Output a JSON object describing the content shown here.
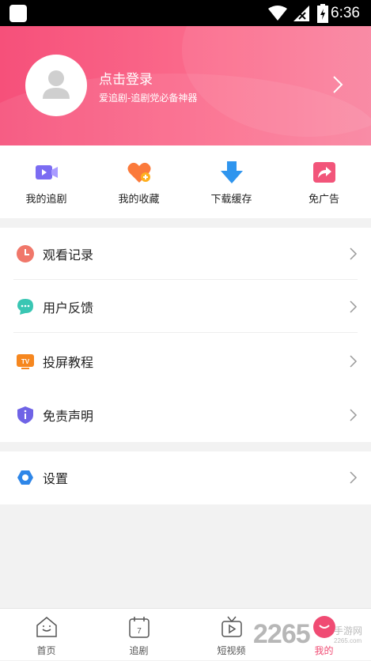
{
  "status_bar": {
    "time": "6:36"
  },
  "profile": {
    "title": "点击登录",
    "subtitle": "爱追剧-追剧党必备神器"
  },
  "quick_actions": [
    {
      "label": "我的追剧",
      "icon": "video-icon"
    },
    {
      "label": "我的收藏",
      "icon": "heart-add-icon"
    },
    {
      "label": "下载缓存",
      "icon": "download-icon"
    },
    {
      "label": "免广告",
      "icon": "share-icon"
    }
  ],
  "menu": [
    {
      "label": "观看记录",
      "icon": "clock-icon"
    },
    {
      "label": "用户反馈",
      "icon": "chat-icon"
    },
    {
      "label": "投屏教程",
      "icon": "tv-icon"
    },
    {
      "label": "免责声明",
      "icon": "shield-info-icon"
    }
  ],
  "settings": {
    "label": "设置",
    "icon": "hexagon-settings-icon"
  },
  "tabs": [
    {
      "label": "首页",
      "icon": "home-icon"
    },
    {
      "label": "追剧",
      "icon": "calendar-icon"
    },
    {
      "label": "短视频",
      "icon": "tv-play-icon"
    },
    {
      "label": "我的",
      "icon": "profile-icon",
      "active": true
    }
  ],
  "watermark": {
    "brand": "2265",
    "text": "手游网",
    "url": "2265.com"
  },
  "colors": {
    "accent": "#f04b73",
    "header_start": "#f6507a",
    "header_end": "#f9839f"
  }
}
